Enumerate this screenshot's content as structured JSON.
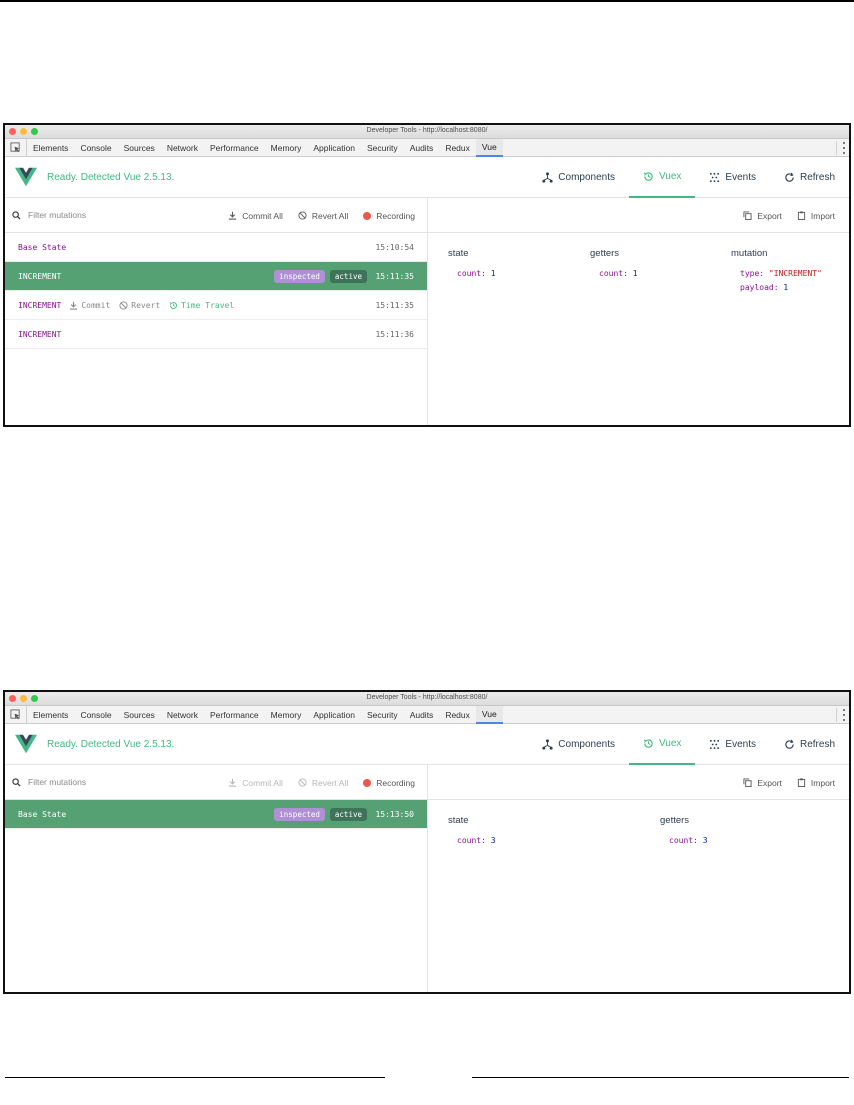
{
  "devtools": {
    "title": "Developer Tools - http://localhost:8080/",
    "tabs": [
      "Elements",
      "Console",
      "Sources",
      "Network",
      "Performance",
      "Memory",
      "Application",
      "Security",
      "Audits",
      "Redux",
      "Vue"
    ],
    "active_tab": "Vue"
  },
  "vue": {
    "ready_text": "Ready. Detected Vue 2.5.13.",
    "nav": {
      "components": "Components",
      "vuex": "Vuex",
      "events": "Events",
      "refresh": "Refresh"
    },
    "toolbar": {
      "filter_placeholder": "Filter mutations",
      "commit_all": "Commit All",
      "revert_all": "Revert All",
      "recording": "Recording",
      "export": "Export",
      "import": "Import"
    },
    "entry_actions": {
      "commit": "Commit",
      "revert": "Revert",
      "time_travel": "Time Travel"
    },
    "tags": {
      "inspected": "inspected",
      "active": "active"
    },
    "headings": {
      "state": "state",
      "getters": "getters",
      "mutation": "mutation"
    },
    "keys": {
      "count": "count",
      "type": "type",
      "payload": "payload"
    }
  },
  "screen1": {
    "entries": [
      {
        "name": "Base State",
        "time": "15:10:54"
      },
      {
        "name": "INCREMENT",
        "time": "15:11:35"
      },
      {
        "name": "INCREMENT",
        "time": "15:11:35"
      },
      {
        "name": "INCREMENT",
        "time": "15:11:36"
      }
    ],
    "state_count": "1",
    "getters_count": "1",
    "mutation_type": "\"INCREMENT\"",
    "mutation_payload": "1"
  },
  "screen2": {
    "entries": [
      {
        "name": "Base State",
        "time": "15:13:50"
      }
    ],
    "state_count": "3",
    "getters_count": "3"
  },
  "colors": {
    "vue_green": "#42b983",
    "selected_row": "#55a174",
    "inspected_tag": "#af90d5",
    "active_tag": "#3e7359",
    "record_red": "#ea5a4b"
  }
}
